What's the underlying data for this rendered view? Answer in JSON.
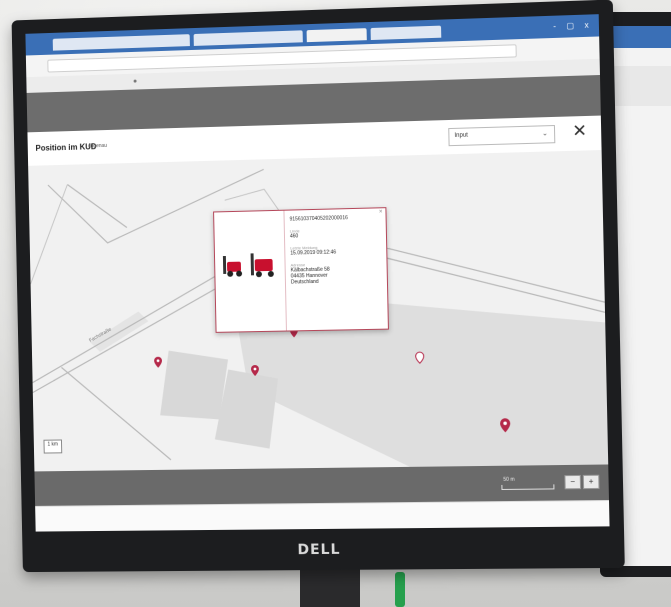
{
  "monitor": {
    "brand": "DELL"
  },
  "browser": {
    "controls": "- ▢ x"
  },
  "app": {
    "title": "Position im KUD",
    "subtitle": "ungenau",
    "dropdown_value": "Input",
    "close_symbol": "✕"
  },
  "popup": {
    "id": "915610370405202000016",
    "label_type": "Linde",
    "value_type": "460",
    "label_time": "Letzte Meldung",
    "value_time": "15.09.2019 09:12:46",
    "label_address": "Adresse",
    "address_lines": [
      "Kälbachstraße 58",
      "04435 Hannover",
      "Deutschland"
    ]
  },
  "map": {
    "street_label": "Fachstraße",
    "scale_left": "1 km",
    "scale_text": "50 m",
    "zoom_in": "+",
    "zoom_out": "−",
    "marker_color": "#b5294a",
    "building_color": "#dedede"
  }
}
